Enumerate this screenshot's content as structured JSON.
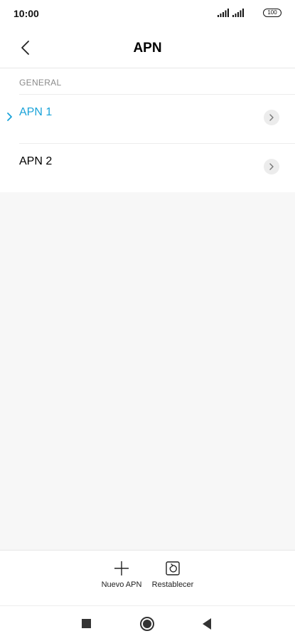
{
  "status_bar": {
    "time": "10:00",
    "battery": "100",
    "icons": [
      "signal-icon",
      "signal-icon",
      "battery-icon"
    ]
  },
  "header": {
    "title": "APN",
    "back_icon": "chevron-left-icon"
  },
  "list": {
    "section_label": "GENERAL",
    "items": [
      {
        "label": "APN 1",
        "selected": true,
        "icon": "chevron-right-icon"
      },
      {
        "label": "APN 2",
        "selected": false,
        "icon": "chevron-right-icon"
      }
    ]
  },
  "bottom_actions": {
    "new": {
      "label": "Nuevo APN",
      "icon": "plus-icon"
    },
    "reset": {
      "label": "Restablecer",
      "icon": "reset-icon"
    }
  },
  "nav": {
    "recents_icon": "square-icon",
    "home_icon": "circle-icon",
    "back_icon": "triangle-back-icon"
  },
  "colors": {
    "accent": "#1aa3d9",
    "background": "#f7f7f7",
    "surface": "#ffffff"
  }
}
